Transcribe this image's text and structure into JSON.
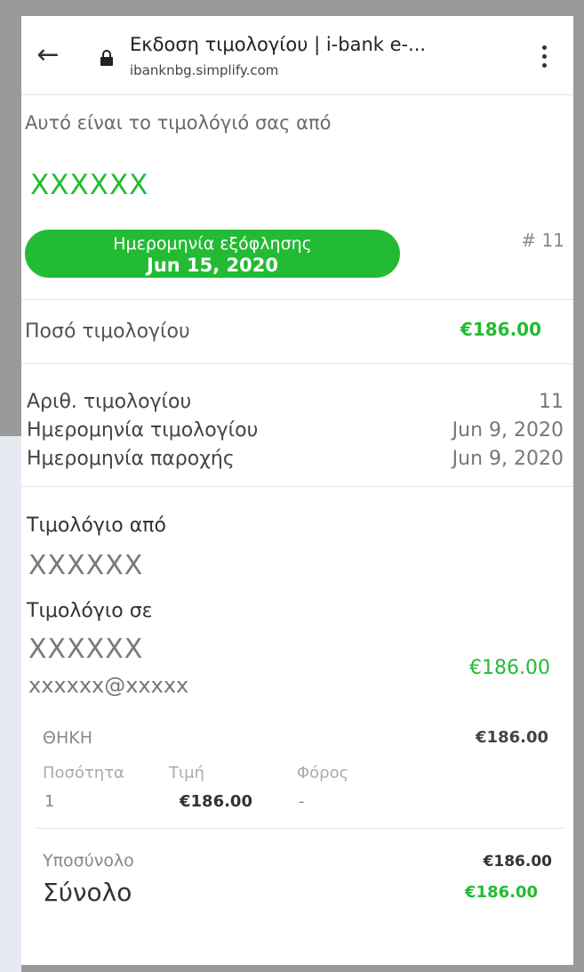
{
  "browser": {
    "title": "Εκδοση τιμολογίου | i-bank e-...",
    "url": "ibanknbg.simplify.com"
  },
  "invoice": {
    "intro": "Αυτό είναι το τιμολόγιό σας από",
    "merchant": "XXXXXX",
    "due_label": "Ημερομηνία εξόφλησης",
    "due_date": "Jun 15, 2020",
    "number_badge": "# 11",
    "amount_label": "Ποσό τιμολογίου",
    "amount_value": "€186.00",
    "details": [
      {
        "label": "Αριθ. τιμολογίου",
        "value": "11"
      },
      {
        "label": "Ημερομηνία τιμολογίου",
        "value": "Jun 9, 2020"
      },
      {
        "label": "Ημερομηνία παροχής",
        "value": "Jun 9, 2020"
      }
    ],
    "from_heading": "Τιμολόγιο από",
    "from_name": "XXXXXX",
    "to_heading": "Τιμολόγιο σε",
    "to_name": "XXXXXX",
    "to_email": "xxxxxx@xxxxx",
    "to_amount": "€186.00"
  },
  "line_item": {
    "name": "ΘΗΚΗ",
    "price": "€186.00",
    "col_qty": "Ποσότητα",
    "col_price": "Τιμή",
    "col_tax": "Φόρος",
    "qty": "1",
    "unit_price": "€186.00",
    "tax": "-"
  },
  "totals": {
    "subtotal_label": "Υποσύνολο",
    "subtotal_value": "€186.00",
    "total_label": "Σύνολο",
    "total_value": "€186.00"
  },
  "colors": {
    "accent": "#22bb33",
    "frame": "#9a9a9a"
  },
  "icons": [
    "back-arrow-icon",
    "lock-icon",
    "kebab-menu-icon"
  ]
}
